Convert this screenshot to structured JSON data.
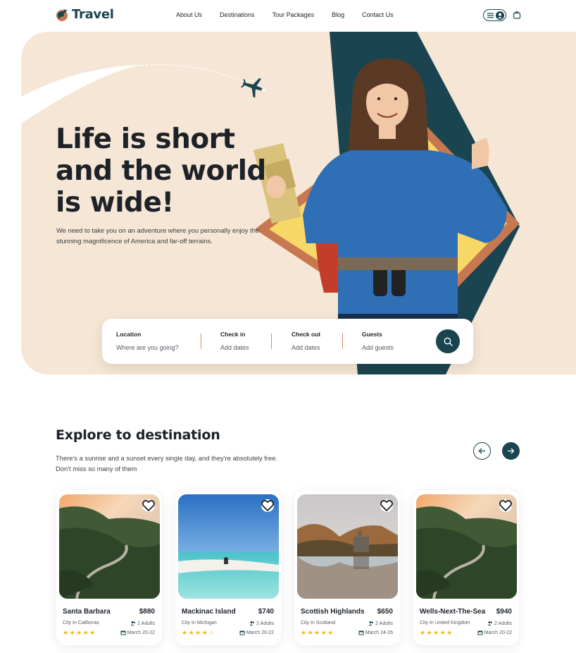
{
  "brand": {
    "name": "Travel",
    "accent": "#1a4450",
    "orange": "#c87850",
    "cream": "#f6e6d6"
  },
  "nav": {
    "links": [
      "About Us",
      "Destinations",
      "Tour Packages",
      "Blog",
      "Contact Us"
    ],
    "menu_icon": "menu-icon",
    "profile_icon": "user-icon",
    "cart_icon": "bag-icon"
  },
  "hero": {
    "title": "Life is short and the world is wide!",
    "subtitle": "We need to take you on an adventure where you personally enjoy the stunning magnificence of America and far-off terrains."
  },
  "search": {
    "fields": [
      {
        "label": "Location",
        "placeholder": "Where are you going?"
      },
      {
        "label": "Check in",
        "placeholder": "Add dates"
      },
      {
        "label": "Check out",
        "placeholder": "Add dates"
      },
      {
        "label": "Guests",
        "placeholder": "Add guests"
      }
    ],
    "button_icon": "search-icon"
  },
  "explore": {
    "title": "Explore to destination",
    "subtitle": "There's a sunrise and a sunset every single day, and they're absolutely free. Don't miss so many of them"
  },
  "cards": [
    {
      "name": "Santa Barbara",
      "price": "$880",
      "location": "City In California",
      "guests": "2 Adults",
      "date": "March 20-22",
      "rating": 5
    },
    {
      "name": "Mackinac Island",
      "price": "$740",
      "location": "City In Michigan",
      "guests": "2 Adults",
      "date": "March 20-22",
      "rating": 4
    },
    {
      "name": "Scottish Highlands",
      "price": "$650",
      "location": "City In Scotland",
      "guests": "2 Adults",
      "date": "March 24-26",
      "rating": 5
    },
    {
      "name": "Wells-Next-The-Sea",
      "price": "$940",
      "location": "City In United Kingdom",
      "guests": "2 Adults",
      "date": "March 20-22",
      "rating": 5
    }
  ]
}
